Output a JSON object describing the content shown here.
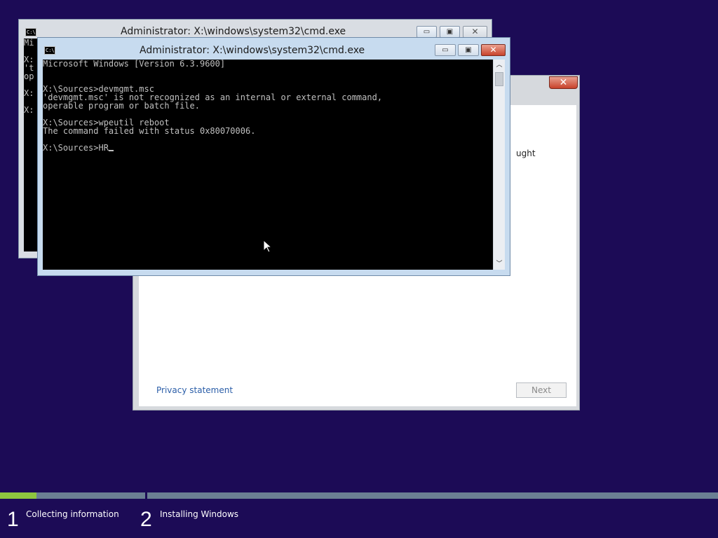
{
  "setup_dialog": {
    "close_glyph": "✕",
    "partial_text": "ught",
    "privacy_link": "Privacy statement",
    "next_button": "Next"
  },
  "back_cmd": {
    "title": "Administrator: X:\\windows\\system32\\cmd.exe",
    "icon_text": "C:\\",
    "partial_lines": [
      "Mi",
      "",
      "X:",
      "'t",
      "op",
      "",
      "X:",
      "",
      "X:"
    ]
  },
  "front_cmd": {
    "title": "Administrator: X:\\windows\\system32\\cmd.exe",
    "icon_text": "C:\\",
    "lines": [
      "Microsoft Windows [Version 6.3.9600]",
      "",
      "",
      "X:\\Sources>devmgmt.msc",
      "'devmgmt.msc' is not recognized as an internal or external command,",
      "operable program or batch file.",
      "",
      "X:\\Sources>wpeutil reboot",
      "The command failed with status 0x80070006.",
      "",
      "X:\\Sources>HR"
    ]
  },
  "caption_buttons": {
    "minimize": "▭",
    "maximize": "▣",
    "close": "✕"
  },
  "steps": [
    {
      "number": "1",
      "label": "Collecting information"
    },
    {
      "number": "2",
      "label": "Installing Windows"
    }
  ],
  "progress": {
    "step1_fraction": 0.25,
    "accent": "#8ec63f",
    "track": "#6b7f93"
  },
  "colors": {
    "desktop": "#1c0b56",
    "console_bg": "#000000",
    "console_fg": "#c0c0c0"
  }
}
